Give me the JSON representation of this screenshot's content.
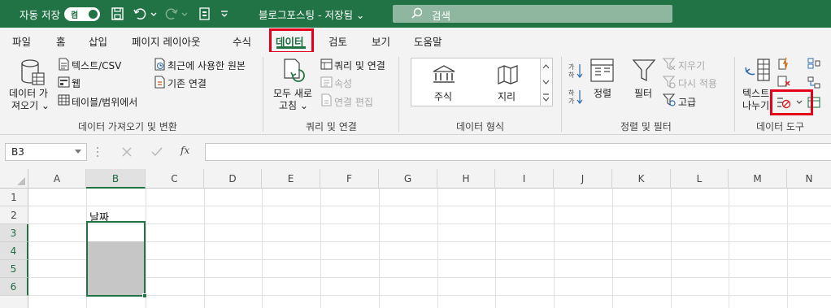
{
  "titlebar": {
    "autosave_label": "자동 저장",
    "autosave_toggle": "켬",
    "doc_title": "블로그포스팅 - 저장됨 ⌄",
    "search_placeholder": "검색"
  },
  "tabs": [
    "파일",
    "홈",
    "삽입",
    "페이지 레이아웃",
    "수식",
    "데이터",
    "검토",
    "보기",
    "도움말"
  ],
  "active_tab": "데이터",
  "ribbon": {
    "get_data": {
      "big_button_line1": "데이터 가",
      "big_button_line2": "져오기 ⌄",
      "text_csv": "텍스트/CSV",
      "web": "웹",
      "table_range": "테이블/범위에서",
      "recent_sources": "최근에 사용한 원본",
      "existing_connections": "기존 연결",
      "group_label": "데이터 가져오기 및 변환"
    },
    "queries": {
      "refresh_all_line1": "모두 새로",
      "refresh_all_line2": "고침 ⌄",
      "queries_connections": "쿼리 및 연결",
      "properties": "속성",
      "edit_links": "연결 편집",
      "group_label": "쿼리 및 연결"
    },
    "data_types": {
      "stocks": "주식",
      "geography": "지리",
      "group_label": "데이터 형식"
    },
    "sort_filter": {
      "sort": "정렬",
      "filter": "필터",
      "clear": "지우기",
      "reapply": "다시 적용",
      "advanced": "고급",
      "group_label": "정렬 및 필터"
    },
    "data_tools": {
      "text_to_columns_line1": "텍스트",
      "text_to_columns_line2": "나누기",
      "group_label": "데이터 도구"
    }
  },
  "formula_bar": {
    "name_box": "B3",
    "fx_label": "fx",
    "formula": ""
  },
  "grid": {
    "columns": [
      "A",
      "B",
      "C",
      "D",
      "E",
      "F",
      "G",
      "H",
      "I",
      "J",
      "K",
      "L",
      "M",
      "N"
    ],
    "rows": [
      "1",
      "2",
      "3",
      "4",
      "5",
      "6"
    ],
    "selected_column": "B",
    "cells": {
      "B2": "날짜"
    }
  },
  "colors": {
    "accent": "#217346",
    "highlight_box": "#e3001b",
    "selection_fill": "#c6c6c6"
  }
}
